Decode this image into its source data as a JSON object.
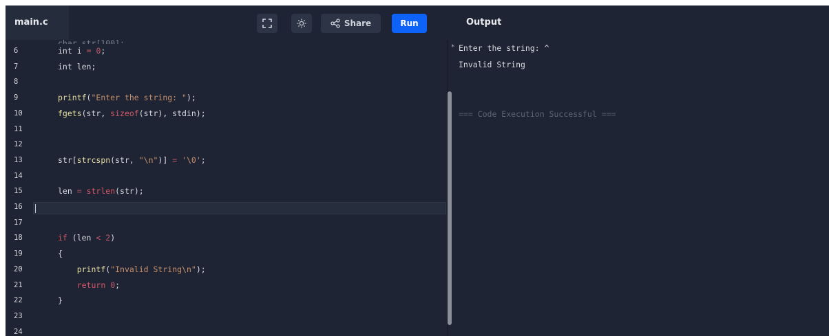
{
  "toolbar": {
    "file_tab": "main.c",
    "share_label": "Share",
    "run_label": "Run",
    "output_title": "Output",
    "icons": [
      "fullscreen-icon",
      "theme-sun-icon",
      "share-icon"
    ]
  },
  "editor": {
    "lines": [
      {
        "n": "6",
        "code": "int i = 0;"
      },
      {
        "n": "7",
        "code": "int len;"
      },
      {
        "n": "8",
        "code": ""
      },
      {
        "n": "9",
        "code": "printf(\"Enter the string: \");"
      },
      {
        "n": "10",
        "code": "fgets(str, sizeof(str), stdin);"
      },
      {
        "n": "11",
        "code": ""
      },
      {
        "n": "12",
        "code": ""
      },
      {
        "n": "13",
        "code": "str[strcspn(str, \"\\n\")] = '\\0';"
      },
      {
        "n": "14",
        "code": ""
      },
      {
        "n": "15",
        "code": "len = strlen(str);"
      },
      {
        "n": "16",
        "code": ""
      },
      {
        "n": "17",
        "code": ""
      },
      {
        "n": "18",
        "code": "if (len < 2)"
      },
      {
        "n": "19",
        "code": "{"
      },
      {
        "n": "20",
        "code": "    printf(\"Invalid String\\n\");"
      },
      {
        "n": "21",
        "code": "    return 0;"
      },
      {
        "n": "22",
        "code": "}"
      },
      {
        "n": "23",
        "code": ""
      },
      {
        "n": "24",
        "code": ""
      }
    ]
  },
  "output": {
    "lines": [
      "Enter the string: ^",
      "Invalid String"
    ],
    "success": "=== Code Execution Successful ==="
  },
  "colors": {
    "background": "#1e2433",
    "run_button": "#0d63f8",
    "keyword": "#d45865",
    "string": "#c8906b",
    "function": "#e8dfa0"
  }
}
